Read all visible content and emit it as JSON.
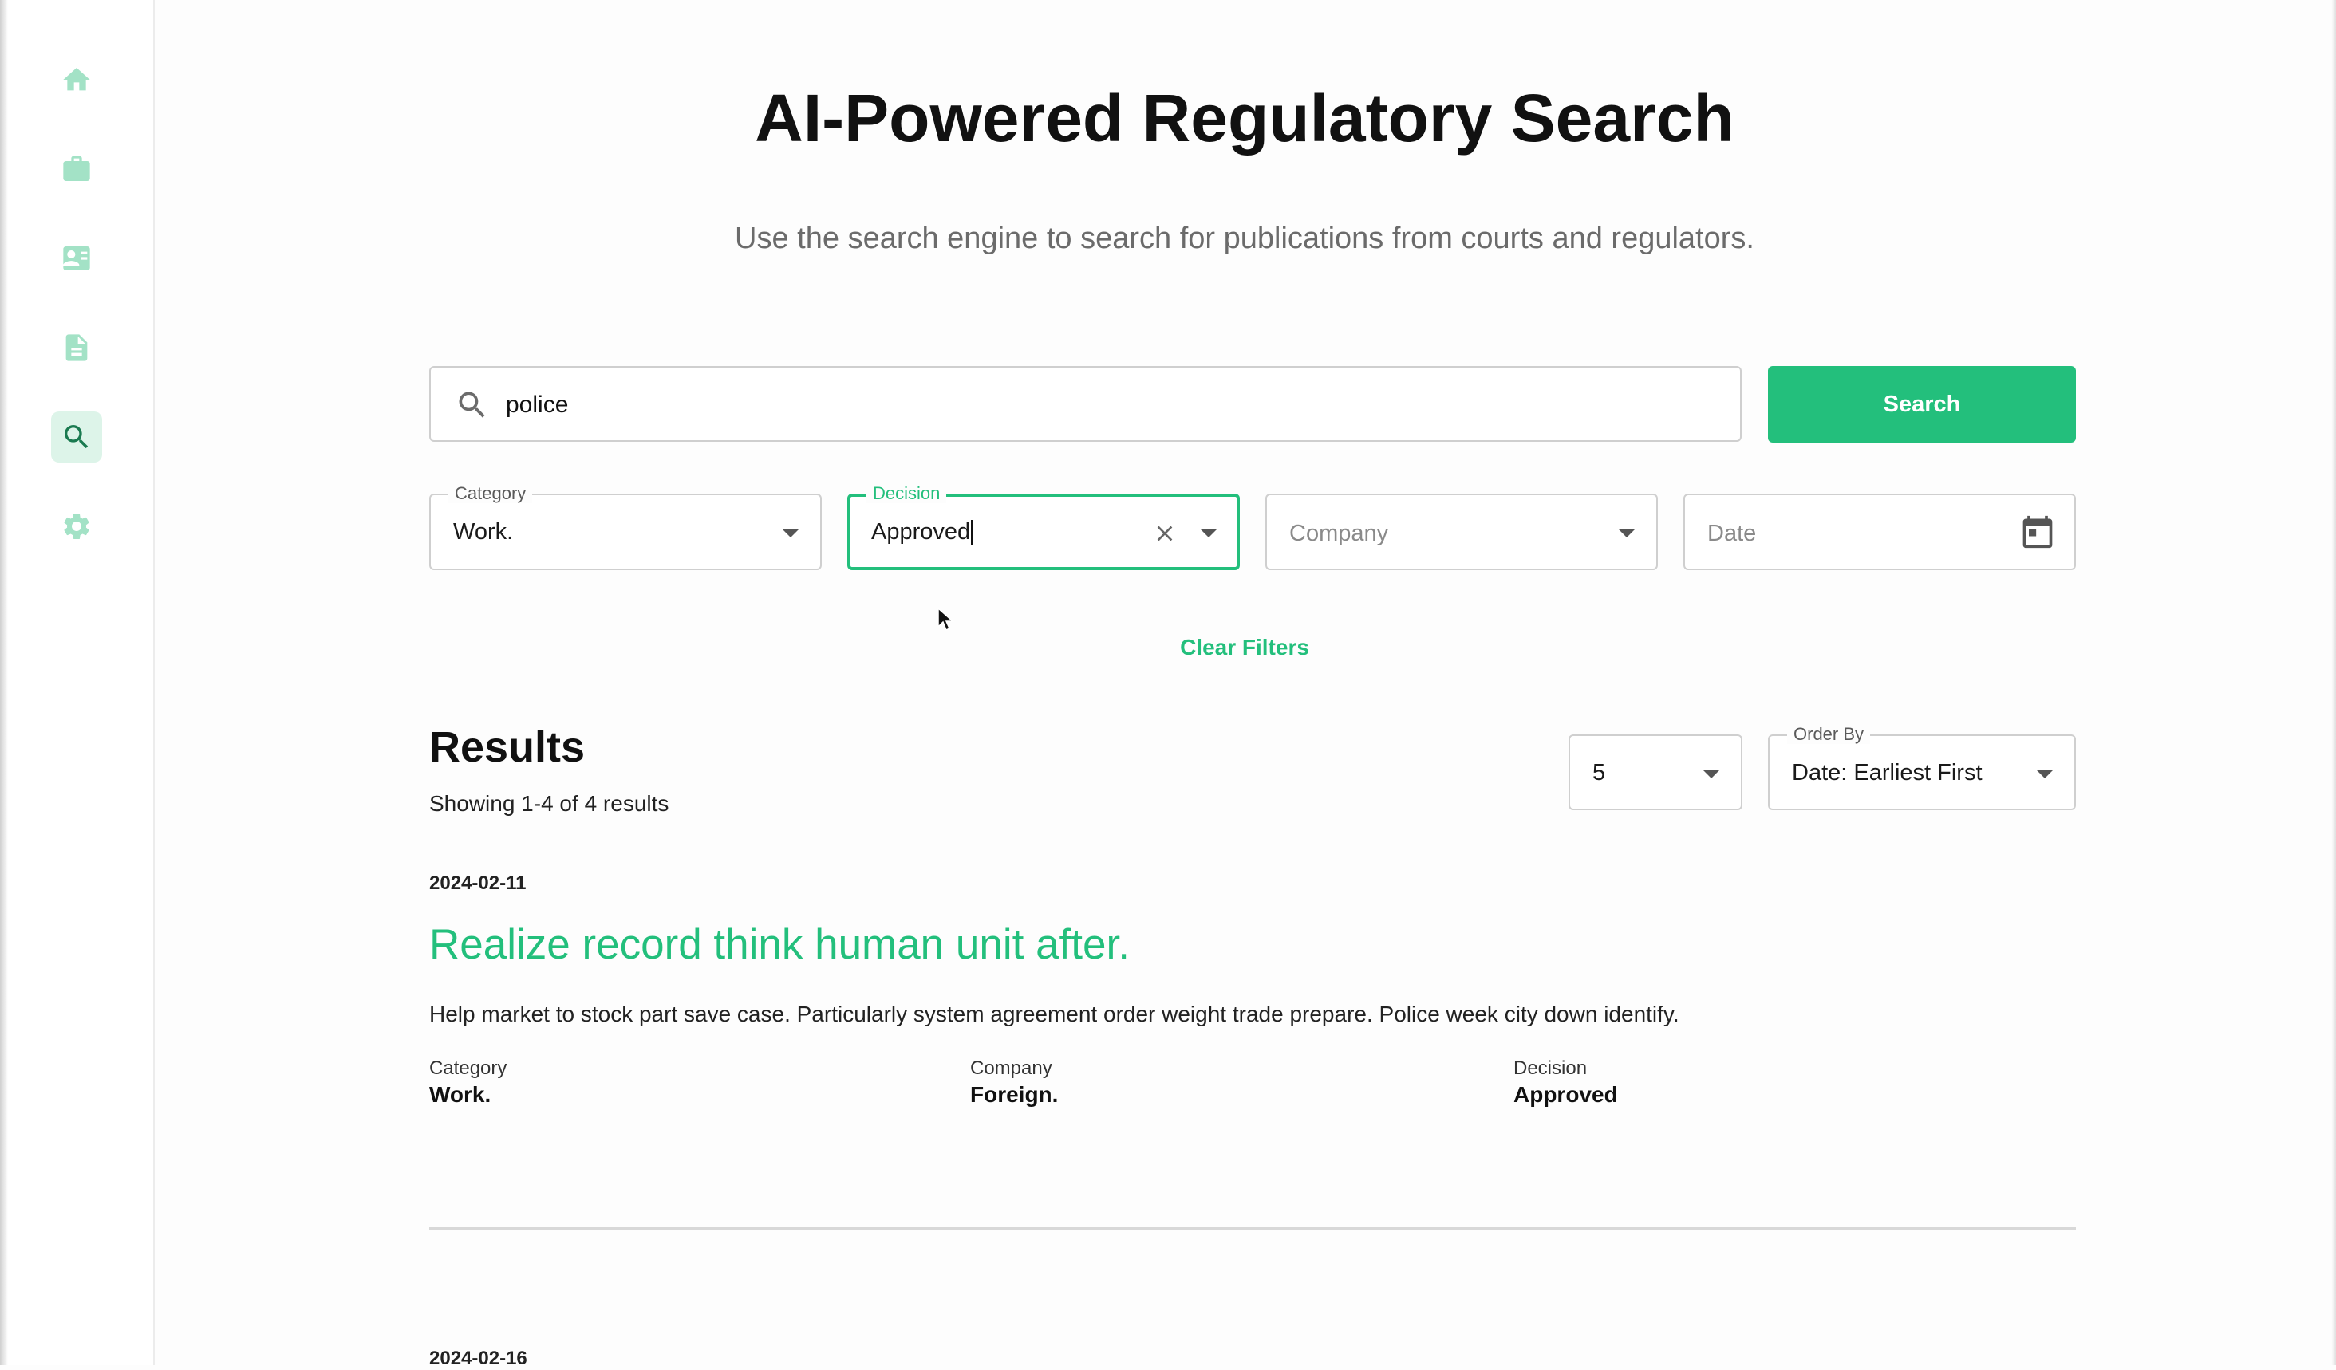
{
  "sidebar": {
    "items": [
      {
        "name": "home",
        "icon": "home-icon",
        "active": false
      },
      {
        "name": "cases",
        "icon": "briefcase-icon",
        "active": false
      },
      {
        "name": "contacts",
        "icon": "contact-card-icon",
        "active": false
      },
      {
        "name": "documents",
        "icon": "document-icon",
        "active": false
      },
      {
        "name": "search",
        "icon": "search-icon",
        "active": true
      },
      {
        "name": "settings",
        "icon": "gear-icon",
        "active": false
      }
    ]
  },
  "header": {
    "title": "AI-Powered Regulatory Search",
    "subtitle": "Use the search engine to search for publications from courts and regulators."
  },
  "search": {
    "value": "police",
    "button_label": "Search"
  },
  "filters": {
    "category": {
      "label": "Category",
      "value": "Work."
    },
    "decision": {
      "label": "Decision",
      "value": "Approved"
    },
    "company": {
      "placeholder": "Company"
    },
    "date": {
      "placeholder": "Date"
    },
    "clear_label": "Clear Filters"
  },
  "results": {
    "heading": "Results",
    "count_text": "Showing 1-4 of 4 results",
    "page_size": "5",
    "order_by": {
      "label": "Order By",
      "value": "Date: Earliest First"
    },
    "items": [
      {
        "date": "2024-02-11",
        "title": "Realize record think human unit after.",
        "description": "Help market to stock part save case. Particularly system agreement order weight trade prepare. Police week city down identify.",
        "meta": [
          {
            "label": "Category",
            "value": "Work."
          },
          {
            "label": "Company",
            "value": "Foreign."
          },
          {
            "label": "Decision",
            "value": "Approved"
          }
        ]
      },
      {
        "date": "2024-02-16"
      }
    ]
  },
  "colors": {
    "accent": "#23bf7c",
    "sidebar_icon": "#a3e2c6",
    "sidebar_active_bg": "#ddf4e9",
    "sidebar_active_icon": "#1a7a50"
  }
}
